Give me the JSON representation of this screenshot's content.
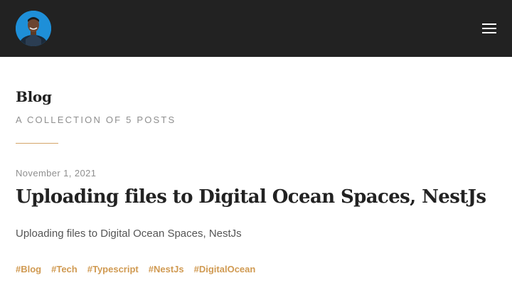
{
  "header": {
    "avatar_icon": "avatar-photo",
    "menu_icon": "hamburger-menu-icon",
    "background_color": "#222222"
  },
  "blog": {
    "title": "Blog",
    "subtitle": "A COLLECTION OF 5 POSTS",
    "accent_color": "#d09a52"
  },
  "posts": [
    {
      "date": "November 1, 2021",
      "title": "Uploading files to Digital Ocean Spaces, NestJs",
      "excerpt": "Uploading files to Digital Ocean Spaces, NestJs",
      "tags": [
        "#Blog",
        "#Tech",
        "#Typescript",
        "#NestJs",
        "#DigitalOcean"
      ]
    }
  ]
}
